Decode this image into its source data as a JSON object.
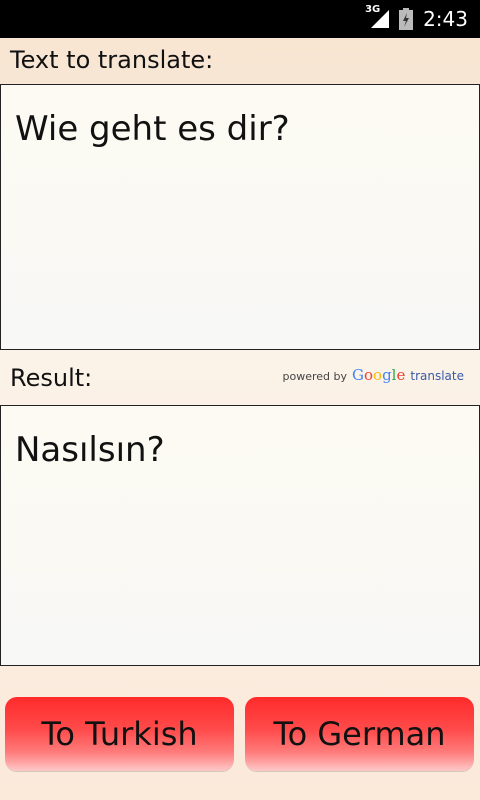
{
  "status_bar": {
    "network_label": "3G",
    "time": "2:43"
  },
  "input_section": {
    "label": "Text to translate:",
    "text": "Wie geht es dir?"
  },
  "result_section": {
    "label": "Result:",
    "text": "Nasılsın?",
    "attribution": {
      "powered_by": "powered by",
      "google_letters": [
        "G",
        "o",
        "o",
        "g",
        "l",
        "e"
      ],
      "translate": "translate"
    }
  },
  "buttons": {
    "to_turkish": "To Turkish",
    "to_german": "To German"
  },
  "colors": {
    "button_red": "#ff2a2a",
    "status_bar": "#000000"
  },
  "icons": {
    "signal": "signal-icon",
    "battery": "battery-charging-icon"
  }
}
